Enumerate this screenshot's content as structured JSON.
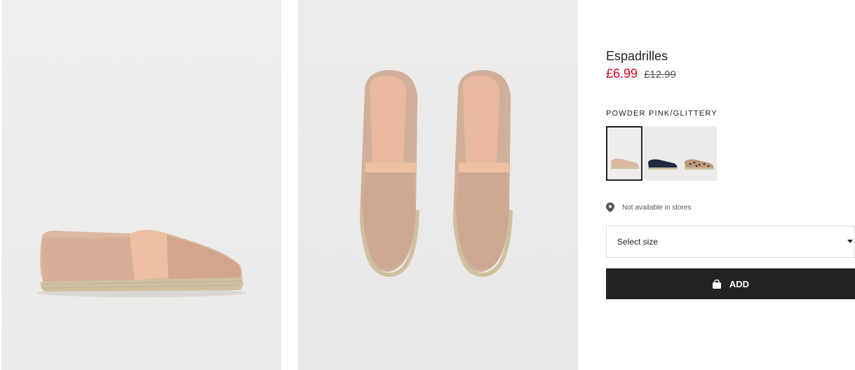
{
  "product": {
    "name": "Espadrilles",
    "price_sale": "£6.99",
    "price_original": "£12.99",
    "color_name": "POWDER PINK/GLITTERY"
  },
  "swatches": [
    {
      "color": "powder pink glittery",
      "selected": true
    },
    {
      "color": "dark blue",
      "selected": false
    },
    {
      "color": "leopard print",
      "selected": false
    }
  ],
  "availability": {
    "icon": "location-pin-icon",
    "text": "Not available in stores"
  },
  "size_select": {
    "label": "Select size",
    "icon": "caret-down-icon"
  },
  "add_button": {
    "label": "ADD",
    "icon": "shopping-bag-icon"
  },
  "theme": {
    "sale_red": "#d6001c",
    "button_black": "#222222",
    "photo_bg": "#edecea"
  }
}
